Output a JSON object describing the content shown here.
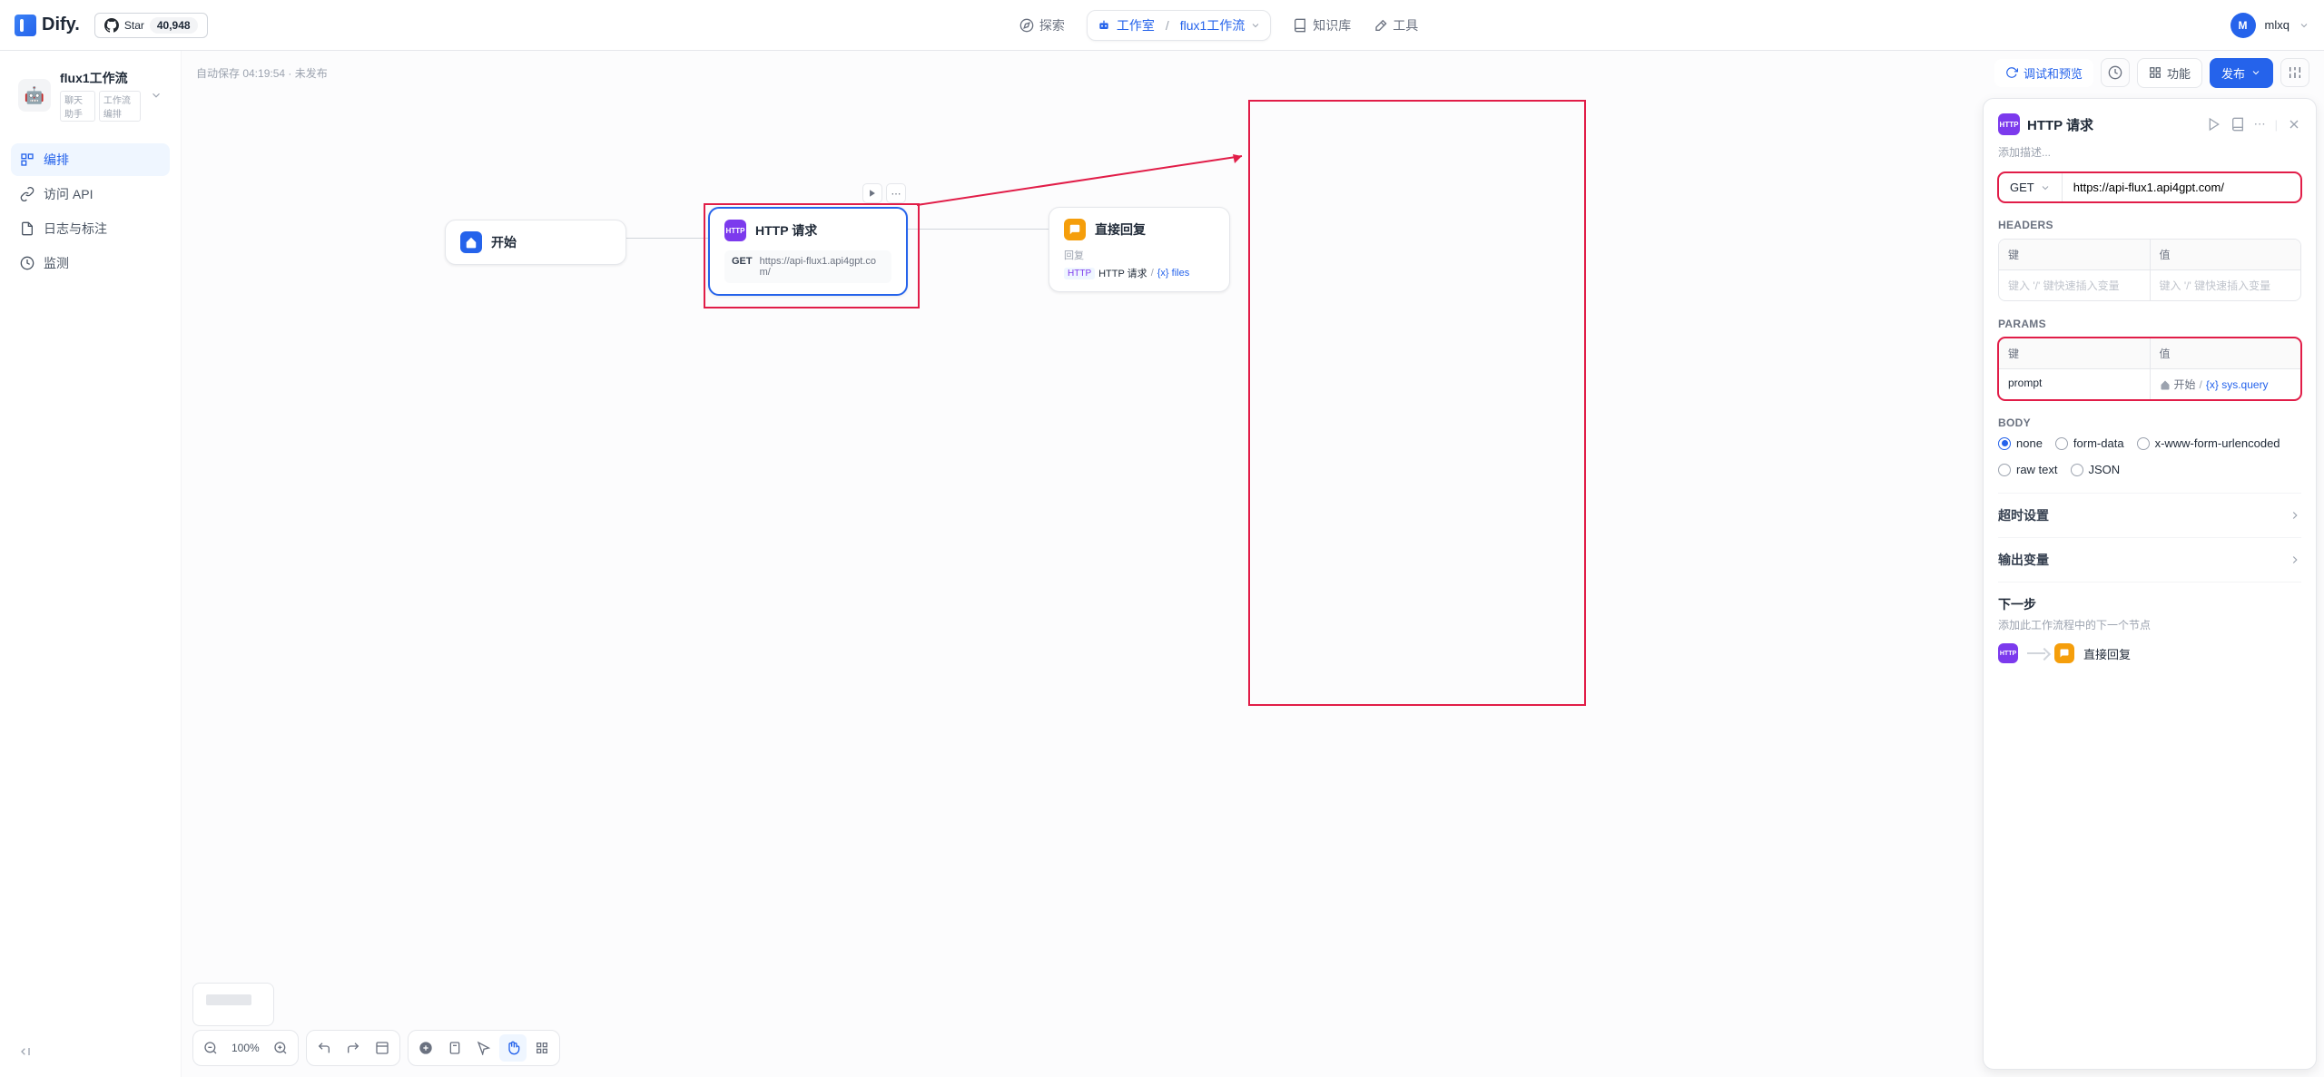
{
  "nav": {
    "logo": "Dify.",
    "github_star": "Star",
    "github_count": "40,948",
    "explore": "探索",
    "studio": "工作室",
    "workflow": "flux1工作流",
    "knowledge": "知识库",
    "tools": "工具",
    "user": "mlxq",
    "user_initial": "M"
  },
  "sidebar": {
    "app_name": "flux1工作流",
    "app_emoji": "🤖",
    "tags": [
      "聊天助手",
      "工作流编排"
    ],
    "items": [
      {
        "label": "编排"
      },
      {
        "label": "访问 API"
      },
      {
        "label": "日志与标注"
      },
      {
        "label": "监测"
      }
    ]
  },
  "canvas": {
    "autosave": "自动保存 04:19:54 · 未发布",
    "debug": "调试和预览",
    "features": "功能",
    "publish": "发布",
    "zoom": "100%",
    "nodes": {
      "start": {
        "title": "开始"
      },
      "http": {
        "title": "HTTP 请求",
        "method": "GET",
        "url": "https://api-flux1.api4gpt.com/"
      },
      "reply": {
        "title": "直接回复",
        "sublabel": "回复",
        "ref_node": "HTTP 请求",
        "ref_var": "{x} files"
      }
    }
  },
  "panel": {
    "title": "HTTP 请求",
    "desc_placeholder": "添加描述...",
    "method": "GET",
    "url": "https://api-flux1.api4gpt.com/",
    "headers_label": "HEADERS",
    "params_label": "PARAMS",
    "body_label": "BODY",
    "col_key": "键",
    "col_value": "值",
    "kv_placeholder": "键入 '/' 键快速插入变量",
    "params": [
      {
        "key": "prompt",
        "ref_node": "开始",
        "ref_var": "{x} sys.query"
      }
    ],
    "body_options": [
      "none",
      "form-data",
      "x-www-form-urlencoded",
      "raw text",
      "JSON"
    ],
    "body_selected": "none",
    "timeout_label": "超时设置",
    "output_label": "输出变量",
    "next_label": "下一步",
    "next_desc": "添加此工作流程中的下一个节点",
    "next_node": "直接回复"
  }
}
